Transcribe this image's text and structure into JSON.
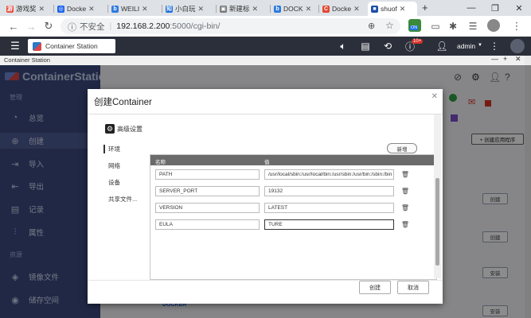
{
  "browser": {
    "tabs": [
      {
        "label": "游戏奖",
        "fav_color": "#e74c3c",
        "fav_glyph": "游"
      },
      {
        "label": "Docke",
        "fav_color": "#1d63ed",
        "fav_glyph": "◎"
      },
      {
        "label": "WEILI",
        "fav_color": "#2d7be0",
        "fav_glyph": "b"
      },
      {
        "label": "小白玩",
        "fav_color": "#1e6fd9",
        "fav_glyph": "知"
      },
      {
        "label": "新建标",
        "fav_color": "#777777",
        "fav_glyph": "▣"
      },
      {
        "label": "DOCK",
        "fav_color": "#2d7be0",
        "fav_glyph": "b"
      },
      {
        "label": "Docke",
        "fav_color": "#e0482f",
        "fav_glyph": "C"
      },
      {
        "label": "shuof",
        "fav_color": "#1d4fa8",
        "fav_glyph": "■"
      }
    ],
    "new_tab": "+",
    "window": {
      "minimize": "—",
      "maximize": "❐",
      "close": "✕"
    },
    "address": {
      "insecure_label": "不安全",
      "host": "192.168.2.200",
      "path": ":5000/cgi-bin/"
    },
    "toolbar_badge_on": "ON",
    "toolbar_badge_count": "10+"
  },
  "qts": {
    "app_tab": "Container Station",
    "user": "admin"
  },
  "cs": {
    "window_title": "Container Station",
    "logo": "ContainerStation",
    "sidebar": {
      "section_manage": "管理",
      "items": [
        {
          "icon": "◔",
          "label": "总览"
        },
        {
          "icon": "⊕",
          "label": "创建"
        },
        {
          "icon": "⇥",
          "label": "导入"
        },
        {
          "icon": "⇤",
          "label": "导出"
        },
        {
          "icon": "▤",
          "label": "记录"
        },
        {
          "icon": "⫶",
          "label": "属性"
        }
      ],
      "section_resources": "资源",
      "items2": [
        {
          "icon": "◈",
          "label": "镜像文件"
        },
        {
          "icon": "◉",
          "label": "储存空间"
        }
      ]
    },
    "main": {
      "create_app_button": "+ 创建应用程序",
      "create_buttons": [
        "创建",
        "创建",
        "安装",
        "安装"
      ],
      "docker_label": "DOCKER"
    }
  },
  "modal": {
    "title": "创建Container",
    "advanced_settings": "高级设置",
    "nav": [
      "环境",
      "网络",
      "设备",
      "共享文件..."
    ],
    "add_button": "新增",
    "columns": {
      "name": "名称",
      "value": "值"
    },
    "env": [
      {
        "name": "PATH",
        "value": "/usr/local/sbin:/usr/local/bin:/usr/sbin:/usr/bin:/sbin:/bin"
      },
      {
        "name": "SERVER_PORT",
        "value": "19132"
      },
      {
        "name": "VERSION",
        "value": "LATEST"
      },
      {
        "name": "EULA",
        "value": "TURE"
      }
    ],
    "create_button": "创建",
    "cancel_button": "取消"
  }
}
